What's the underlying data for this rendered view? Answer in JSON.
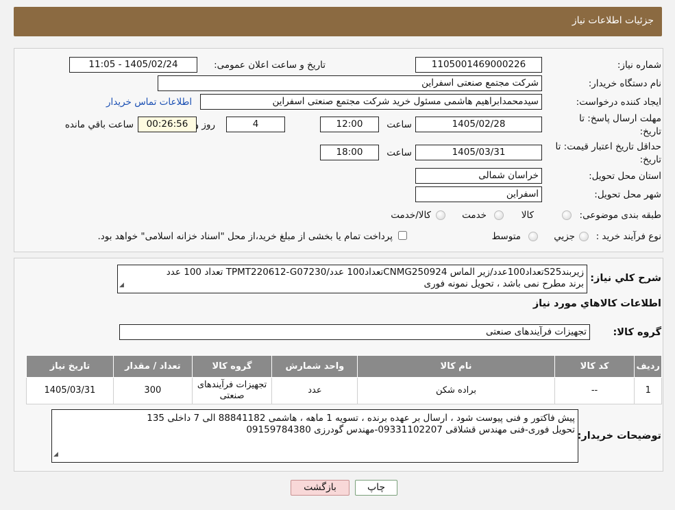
{
  "header": {
    "title": "جزئیات اطلاعات نیاز"
  },
  "form": {
    "need_number_label": "شماره نیاز:",
    "need_number": "1105001469000226",
    "announce_label": "تاریخ و ساعت اعلان عمومی:",
    "announce_value": "1405/02/24 - 11:05",
    "buyer_org_label": "نام دستگاه خریدار:",
    "buyer_org": "شرکت مجتمع صنعتی اسفراین",
    "creator_label": "ایجاد کننده درخواست:",
    "creator": "سیدمحمدابراهیم هاشمی مسئول خرید شرکت مجتمع صنعتی اسفراین",
    "contact_link": "اطلاعات تماس خریدار",
    "deadline_label_1": "مهلت ارسال پاسخ: تا",
    "deadline_label_2": "تاریخ:",
    "deadline_date": "1405/02/28",
    "time_label": "ساعت",
    "deadline_time": "12:00",
    "days_value": "4",
    "days_label": "روز و",
    "remaining_value": "00:26:56",
    "remaining_label": "ساعت باقي مانده",
    "validity_label_1": "حداقل تاریخ اعتبار قیمت: تا",
    "validity_label_2": "تاریخ:",
    "validity_date": "1405/03/31",
    "validity_time": "18:00",
    "province_label": "استان محل تحویل:",
    "province": "خراسان شمالی",
    "city_label": "شهر محل تحویل:",
    "city": "اسفراین",
    "category_label": "طبقه بندی موضوعی:",
    "category_options": [
      "کالا",
      "خدمت",
      "کالا/خدمت"
    ],
    "process_label": "نوع فرآیند خرید :",
    "process_options": [
      "جزیي",
      "متوسط"
    ],
    "process_note": "پرداخت تمام یا بخشی از مبلغ خرید،از محل \"اسناد خزانه اسلامی\" خواهد بود."
  },
  "summary": {
    "label": "شرح كلي نياز:",
    "line1": "زیربندS25تعداد100عدد/زیر الماس CNMG250924تعداد100 عدد/TPMT220612-G07230 تعداد 100 عدد",
    "line2": "برند مطرح نمی باشد ، تحویل نمونه فوری"
  },
  "goods": {
    "section_title": "اطلاعات كالاهاي مورد نياز",
    "group_label": "گروه کالا:",
    "group_value": "تجهیزات فرآیندهای صنعتی",
    "table": {
      "headers": [
        "رديف",
        "کد کالا",
        "نام کالا",
        "واحد شمارش",
        "گروه کالا",
        "تعداد / مقدار",
        "تاریخ نیاز"
      ],
      "rows": [
        [
          "1",
          "--",
          "براده شکن",
          "عدد",
          "تجهیزات فرآیندهای صنعتی",
          "300",
          "1405/03/31"
        ]
      ]
    }
  },
  "buyer_notes": {
    "label": "توضیحات خریدار:",
    "line1": "پیش فاکتور و فنی پیوست شود ، ارسال بر عهده برنده ، تسویه 1 ماهه ، هاشمی 88841182 الی 7 داخلی 135",
    "line2": "تحویل فوری-فنی مهندس قشلاقی 09331102207-مهندس گودرزی 09159784380"
  },
  "buttons": {
    "print": "چاپ",
    "back": "بازگشت"
  },
  "colors": {
    "header_bg": "#8b6a41",
    "table_header_bg": "#8a8a8a",
    "back_button_bg": "#f8d8d8",
    "link": "#1a4fb3"
  }
}
